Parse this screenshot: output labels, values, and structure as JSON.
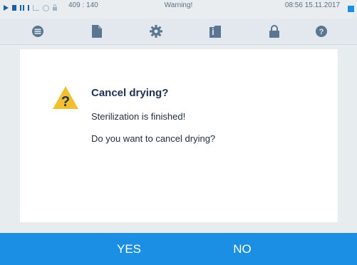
{
  "status_bar": {
    "coords": "409 : 140",
    "title": "Warning!",
    "datetime": "08:56  15.11.2017",
    "icons": [
      "play-icon",
      "document-icon",
      "program-bars-icon",
      "chart-icon",
      "clock-icon",
      "lock-icon"
    ],
    "indicator_color": "#1a8fe3"
  },
  "nav": {
    "items": [
      {
        "icon": "menu-icon"
      },
      {
        "icon": "document-icon"
      },
      {
        "icon": "settings-gear-icon"
      },
      {
        "icon": "info-folder-icon"
      },
      {
        "icon": "lock-icon"
      },
      {
        "icon": "help-icon"
      }
    ],
    "icon_color": "#5b7690"
  },
  "dialog": {
    "icon": "warning-icon",
    "title": "Cancel drying?",
    "message_1": "Sterilization is finished!",
    "message_2": "Do you want to cancel drying?"
  },
  "actions": {
    "yes_label": "YES",
    "no_label": "NO",
    "bar_color": "#1a8fe3"
  }
}
